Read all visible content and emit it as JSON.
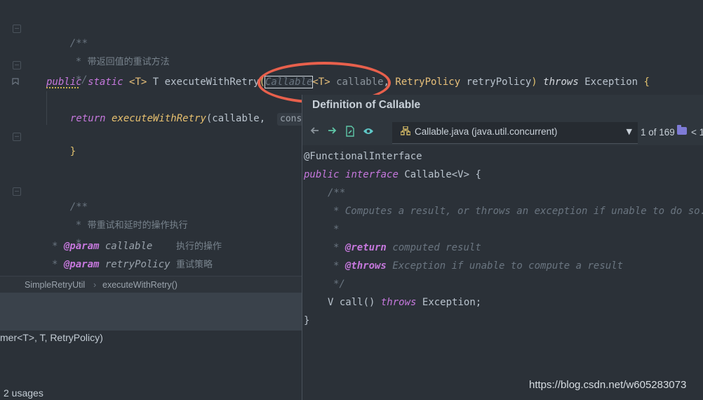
{
  "editor": {
    "lines": {
      "doc1_open": "/**",
      "doc1_desc": "带返回值的重试方法",
      "doc1_close": "*/",
      "sig_public": "public",
      "sig_static": "static",
      "sig_typeparam": "<T>",
      "sig_return": "T",
      "sig_method": "executeWithRetry",
      "sig_paren": "(",
      "sig_callable": "Callable",
      "sig_callable_generic": "<T>",
      "sig_callable_name": "callable",
      "sig_comma": ",",
      "sig_retry_type": "RetryPolicy",
      "sig_retry_name": "retryPolicy",
      "sig_close": ")",
      "sig_throws": "throws",
      "sig_exception": "Exception",
      "sig_brace": "{",
      "ret_kw": "return",
      "ret_call": "executeWithRetry",
      "ret_args": "(callable,",
      "ret_hint": "consu",
      "close_brace": "}",
      "doc2_open": "/**",
      "doc2_desc": "带重试和延时的操作执行",
      "doc2_star": "*",
      "param_tag": "@param",
      "param1_name": "callable",
      "param1_desc": "执行的操作",
      "param2_name": "retryPolicy",
      "param2_desc": "重试策略"
    }
  },
  "breadcrumb": {
    "class_name": "SimpleRetryUtil",
    "separator": "›",
    "method_name": "executeWithRetry()"
  },
  "usages": {
    "signature_fragment": "mer<T>, T, RetryPolicy)",
    "count_label": "2 usages"
  },
  "popup": {
    "title": "Definition of Callable",
    "toolbar": {
      "back_icon": "arrow-left-icon",
      "forward_icon": "arrow-right-icon",
      "edit_source_icon": "file-edit-icon",
      "view_icon": "eye-icon",
      "file_label": "Callable.java (java.util.concurrent)",
      "counter": "1 of 169",
      "nav_prev": "< 1"
    },
    "code": {
      "annotation": "@FunctionalInterface",
      "public": "public",
      "interface": "interface",
      "iface_decl": "Callable<V> {",
      "doc_open": "/**",
      "doc_line1": "* Computes a result, or throws an exception if unable to do so.",
      "doc_star": "*",
      "return_tag": "@return",
      "return_desc": "computed result",
      "throws_tag": "@throws",
      "throws_desc": "Exception if unable to compute a result",
      "doc_close": "*/",
      "method_sig_pre": "V call()",
      "method_throws": "throws",
      "method_exc": "Exception;",
      "closing": "}"
    }
  },
  "watermark": "https://blog.csdn.net/w605283073",
  "colors": {
    "background": "#2b3138",
    "keyword": "#c678dd",
    "type": "#e8c07a",
    "annotation_circle": "#e8604c"
  }
}
